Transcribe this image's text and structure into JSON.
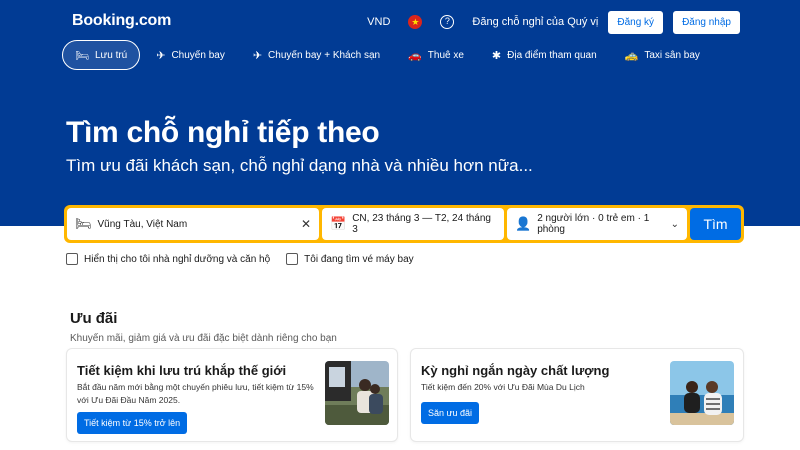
{
  "header": {
    "logo": "Booking.com",
    "currency": "VND",
    "help_icon": "?",
    "list_property": "Đăng chỗ nghỉ của Quý vị",
    "register": "Đăng ký",
    "login": "Đăng nhập"
  },
  "nav": [
    {
      "label": "Lưu trú",
      "icon": "bed-icon",
      "glyph": "🛏",
      "active": true
    },
    {
      "label": "Chuyến bay",
      "icon": "plane-icon",
      "glyph": "✈",
      "active": false
    },
    {
      "label": "Chuyến bay + Khách sạn",
      "icon": "flight-hotel-icon",
      "glyph": "✈",
      "active": false
    },
    {
      "label": "Thuê xe",
      "icon": "car-icon",
      "glyph": "🚗",
      "active": false
    },
    {
      "label": "Địa điểm tham quan",
      "icon": "attractions-icon",
      "glyph": "✱",
      "active": false
    },
    {
      "label": "Taxi sân bay",
      "icon": "taxi-icon",
      "glyph": "🚕",
      "active": false
    }
  ],
  "hero": {
    "title": "Tìm chỗ nghỉ tiếp theo",
    "subtitle": "Tìm ưu đãi khách sạn, chỗ nghỉ dạng nhà và nhiều hơn nữa..."
  },
  "search": {
    "destination": "Vũng Tàu, Việt Nam",
    "dates": "CN, 23 tháng 3  —  T2, 24 tháng 3",
    "guests": "2 người lớn · 0 trẻ em · 1 phòng",
    "button": "Tìm"
  },
  "checkboxes": {
    "homes": "Hiển thị cho tôi nhà nghỉ dưỡng và căn hộ",
    "flights": "Tôi đang tìm vé máy bay"
  },
  "offers": {
    "title": "Ưu đãi",
    "subtitle": "Khuyến mãi, giảm giá và ưu đãi đặc biệt dành riêng cho bạn",
    "cards": [
      {
        "title": "Tiết kiệm khi lưu trú khắp thế giới",
        "desc": "Bắt đầu năm mới bằng một chuyến phiêu lưu, tiết kiệm từ 15% với Ưu Đãi Đầu Năm 2025.",
        "button": "Tiết kiệm từ 15% trở lên"
      },
      {
        "title": "Kỳ nghỉ ngắn ngày chất lượng",
        "desc": "Tiết kiệm đến 20% với Ưu Đãi Mùa Du Lịch",
        "button": "Săn ưu đãi"
      }
    ]
  },
  "colors": {
    "brand_blue": "#013b94",
    "action_blue": "#006ce4",
    "search_yellow": "#ffb700"
  }
}
